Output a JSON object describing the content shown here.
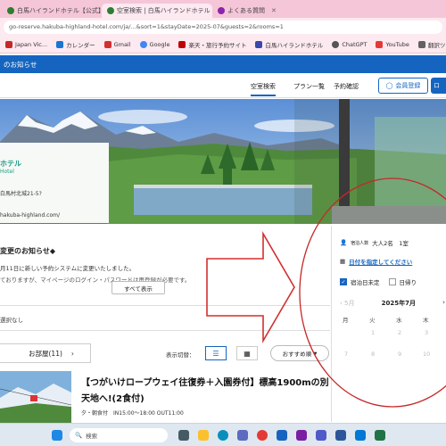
{
  "browser": {
    "tabs": [
      {
        "label": "白馬ハイランドホテル【公式】予約",
        "active": false,
        "color": "#2e7d32"
      },
      {
        "label": "空室検索 | 白馬ハイランドホテル",
        "active": true,
        "color": "#2e7d32"
      },
      {
        "label": "よくある質問",
        "active": false,
        "color": "#8e24aa"
      }
    ],
    "url": "go-reserve.hakuba-highland-hotel.com/ja/...&sort=1&stayDate=2025-07&guests=2&rooms=1"
  },
  "bookmarks": [
    {
      "label": "Japan Vic...",
      "color": "#c62828"
    },
    {
      "label": "カレンダー",
      "color": "#1976d2"
    },
    {
      "label": "Gmail",
      "color": "#d32f2f"
    },
    {
      "label": "Google",
      "color": "#4285f4"
    },
    {
      "label": "楽天・旅行予約サイト",
      "color": "#bf0000"
    },
    {
      "label": "白馬ハイランドホテル",
      "color": "#3949ab"
    },
    {
      "label": "ChatGPT",
      "color": "#555555"
    },
    {
      "label": "YouTube",
      "color": "#e53935"
    },
    {
      "label": "翻訳ツール",
      "color": "#616161"
    }
  ],
  "site": {
    "header_text": "のお知らせ",
    "nav": {
      "search": "空室検索",
      "plans": "プラン一覧",
      "confirm": "予約確認",
      "member": "会員登録",
      "login": "ロ"
    }
  },
  "hotel": {
    "logo": "ホテル",
    "logo_sub": "Hotel",
    "address": "白馬村北城21-5?",
    "url": "hakuba-highland.com/"
  },
  "notice": {
    "title": "変更のお知らせ◆",
    "line1": "月11日に新しい予約システムに変更いたしました。",
    "line2": "ておりますが、マイページのログイン・パスワードは再登録が必要です。",
    "show_all": "すべて表示"
  },
  "filter": {
    "no_selection": "選択なし"
  },
  "toolbar": {
    "room_count": "お部屋(11)",
    "display_switch": "表示切替：",
    "sort": "おすすめ順"
  },
  "plan": {
    "title": "【つがいけロープウェイ往復券＋入園券付】標高1900mの別天地へ!(2食付)",
    "meta": "夕・朝食付　IN15:00〜18:00 OUT11:00"
  },
  "search_panel": {
    "guests": "大人2名　1室",
    "guests_label": "宿泊人数",
    "date_link": "日付を指定してください",
    "stay_date_opt": "宿泊日未定",
    "daytrip_opt": "日帰り",
    "prev": "5月",
    "month": "2025年7月",
    "days_of_week": [
      "月",
      "火",
      "水",
      "木"
    ],
    "day_numbers": [
      [
        "",
        "1",
        "2",
        "3"
      ],
      [
        "7",
        "8",
        "9",
        "10"
      ]
    ]
  },
  "taskbar": {
    "search_placeholder": "検索"
  }
}
